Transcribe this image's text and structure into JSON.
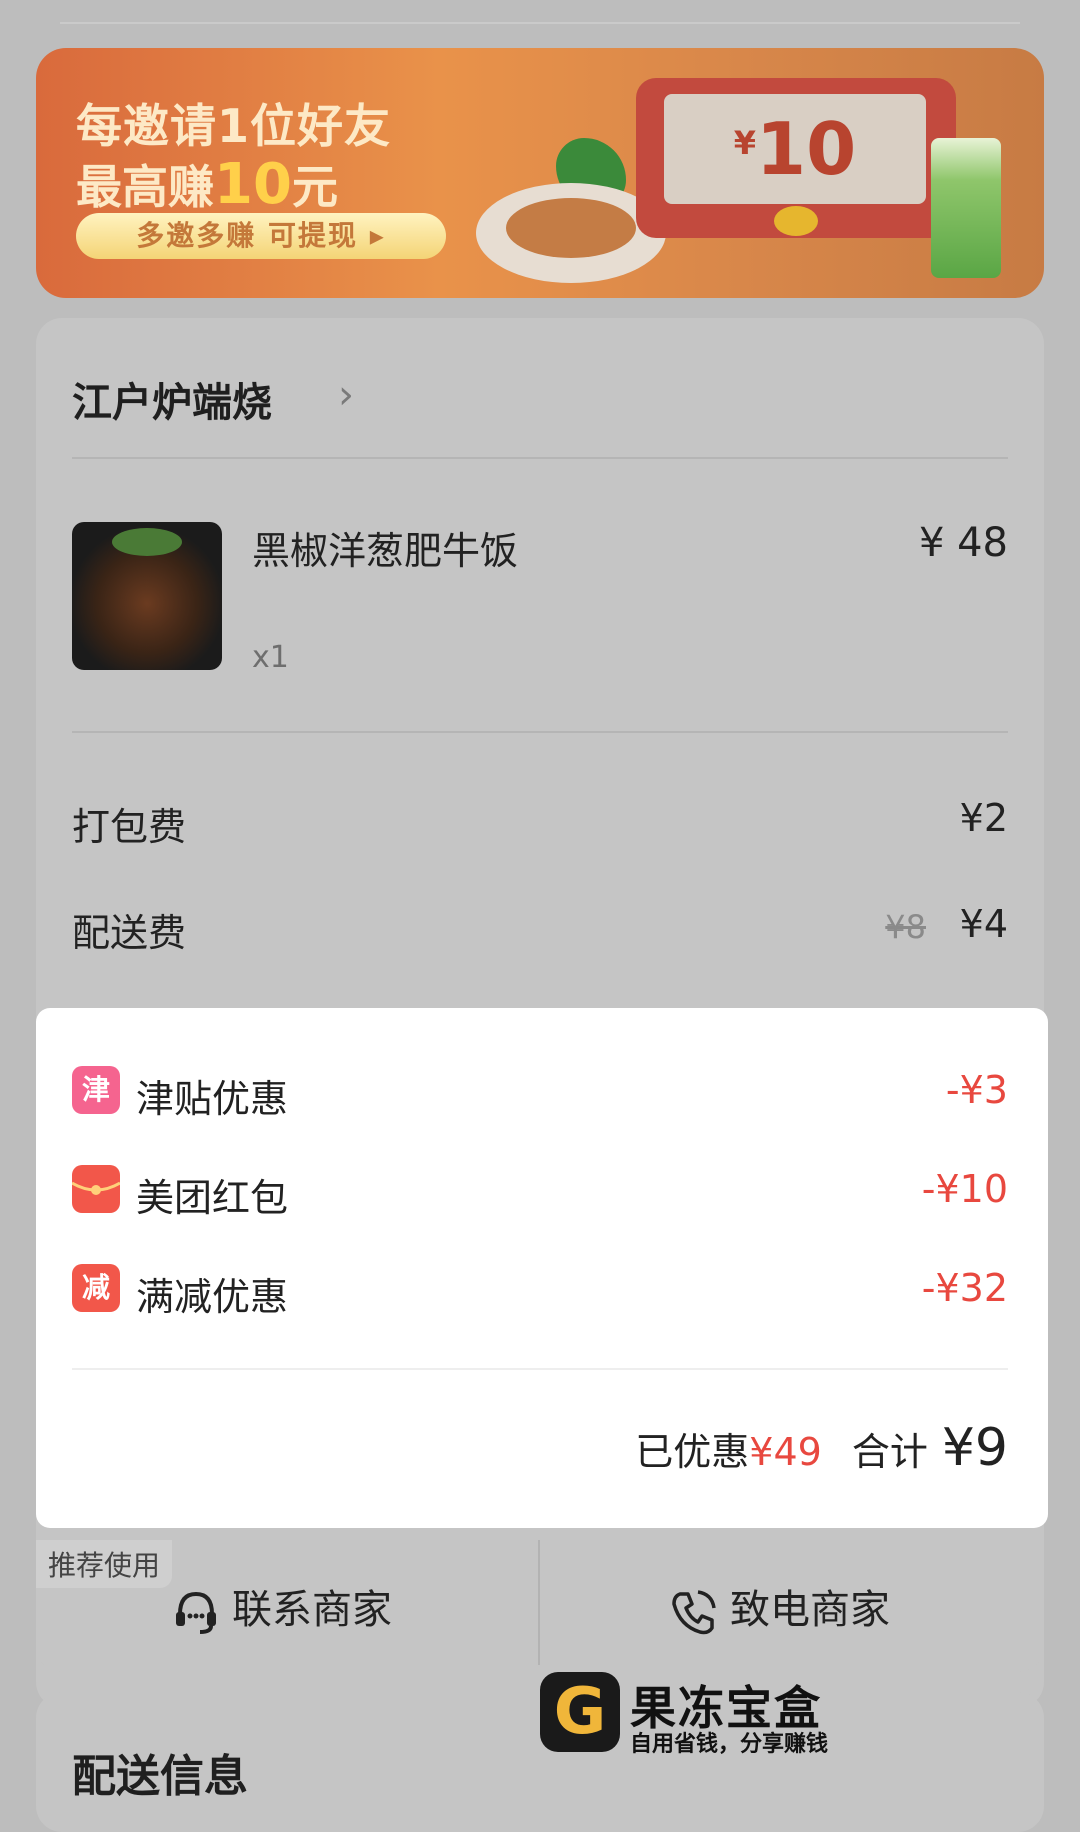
{
  "banner": {
    "line1": "每邀请1位好友",
    "line2_prefix": "最高赚",
    "line2_amount": "10",
    "line2_suffix": "元",
    "button": "多邀多赚 可提现 ▸",
    "coupon_currency": "¥",
    "coupon_amount": "10"
  },
  "shop": {
    "name": "江户炉端烧",
    "chevron": "›"
  },
  "item": {
    "name": "黑椒洋葱肥牛饭",
    "quantity": "x1",
    "price": "¥ 48"
  },
  "fees": {
    "packing_label": "打包费",
    "packing_value": "¥2",
    "delivery_label": "配送费",
    "delivery_original": "¥8",
    "delivery_value": "¥4"
  },
  "discounts": [
    {
      "icon_text": "津",
      "icon": "subsidy-icon",
      "color": "#f5648f",
      "label": "津贴优惠",
      "amount": "-¥3"
    },
    {
      "icon_text": "",
      "icon": "red-packet-icon",
      "color": "#f2574a",
      "label": "美团红包",
      "amount": "-¥10"
    },
    {
      "icon_text": "减",
      "icon": "discount-icon",
      "color": "#f2574a",
      "label": "满减优惠",
      "amount": "-¥32"
    }
  ],
  "summary": {
    "saved_label": "已优惠",
    "saved_value": "¥49",
    "total_label": "合计",
    "total_value": "¥9"
  },
  "contact": {
    "tag": "推荐使用",
    "chat_label": "联系商家",
    "chat_icon": "chat-headset-icon",
    "call_label": "致电商家",
    "call_icon": "phone-icon"
  },
  "delivery": {
    "title": "配送信息"
  },
  "watermark": {
    "logo": "G",
    "title": "果冻宝盒",
    "subtitle": "自用省钱，分享赚钱"
  }
}
